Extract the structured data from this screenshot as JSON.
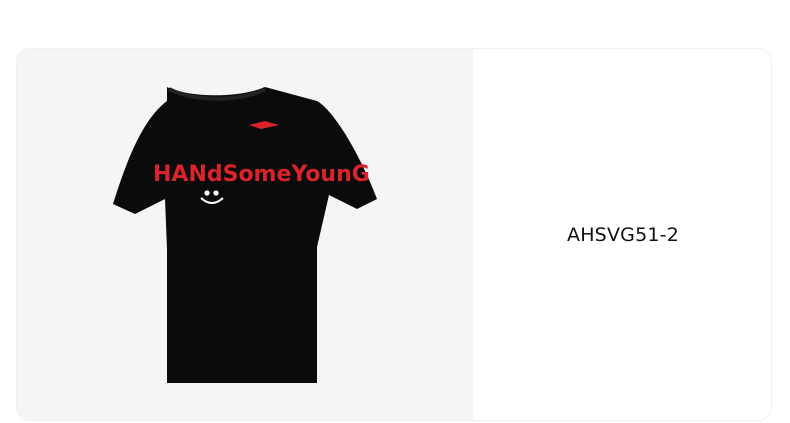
{
  "product": {
    "code": "AHSVG51-2",
    "image": {
      "icon": "black-tshirt-icon",
      "brand_logo_icon": "li-ning-logo-icon",
      "print_text": "HANdSomeYounG",
      "colors": {
        "shirt": "#0b0b0b",
        "print_red": "#d8242a",
        "print_white": "#ffffff",
        "background": "#f5f5f5"
      }
    }
  }
}
